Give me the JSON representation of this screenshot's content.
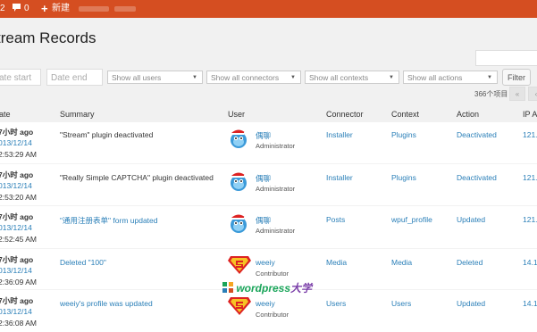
{
  "admin_bar": {
    "updates": "2",
    "comments": "0",
    "new_label": "新建"
  },
  "page": {
    "title": "tream Records"
  },
  "filters": {
    "date_start": "ate start",
    "date_end": "Date end",
    "users": "Show all users",
    "connectors": "Show all connectors",
    "contexts": "Show all contexts",
    "actions": "Show all actions",
    "filter_button": "Filter"
  },
  "pagination": {
    "count": "366个项目",
    "first": "«",
    "prev": "‹"
  },
  "table": {
    "headers": [
      "ate",
      "Summary",
      "User",
      "Connector",
      "Context",
      "Action",
      "IP A"
    ],
    "rows": [
      {
        "date_rel": "7小时 ago",
        "date": "013/12/14",
        "time": "2:53:29 AM",
        "summary": "\"Stream\" plugin deactivated",
        "summary_link": false,
        "user": "偶聊",
        "role": "Administrator",
        "avatar": "bird",
        "connector": "Installer",
        "context": "Plugins",
        "action": "Deactivated",
        "ip": "121."
      },
      {
        "date_rel": "7小时 ago",
        "date": "013/12/14",
        "time": "2:53:20 AM",
        "summary": "\"Really Simple CAPTCHA\" plugin deactivated",
        "summary_link": false,
        "user": "偶聊",
        "role": "Administrator",
        "avatar": "bird",
        "connector": "Installer",
        "context": "Plugins",
        "action": "Deactivated",
        "ip": "121."
      },
      {
        "date_rel": "7小时 ago",
        "date": "013/12/14",
        "time": "2:52:45 AM",
        "summary": "\"通用注册表单\" form updated",
        "summary_link": true,
        "user": "偶聊",
        "role": "Administrator",
        "avatar": "bird",
        "connector": "Posts",
        "context": "wpuf_profile",
        "action": "Updated",
        "ip": "121."
      },
      {
        "date_rel": "7小时 ago",
        "date": "013/12/14",
        "time": "2:36:09 AM",
        "summary": "Deleted \"100\"",
        "summary_link": true,
        "user": "weeiy",
        "role": "Contributor",
        "avatar": "super",
        "connector": "Media",
        "context": "Media",
        "action": "Deleted",
        "ip": "14.1"
      },
      {
        "date_rel": "7小时 ago",
        "date": "013/12/14",
        "time": "2:36:08 AM",
        "summary": "weeiy's profile was updated",
        "summary_link": true,
        "user": "weeiy",
        "role": "Contributor",
        "avatar": "super",
        "connector": "Users",
        "context": "Users",
        "action": "Updated",
        "ip": "14.1"
      }
    ]
  },
  "watermark": {
    "text_latin": "wordpress",
    "text_cjk": "大学"
  },
  "colors": {
    "admin_bar": "#d54e21",
    "link": "#2a7fb8",
    "watermark": "#1aa55a"
  }
}
